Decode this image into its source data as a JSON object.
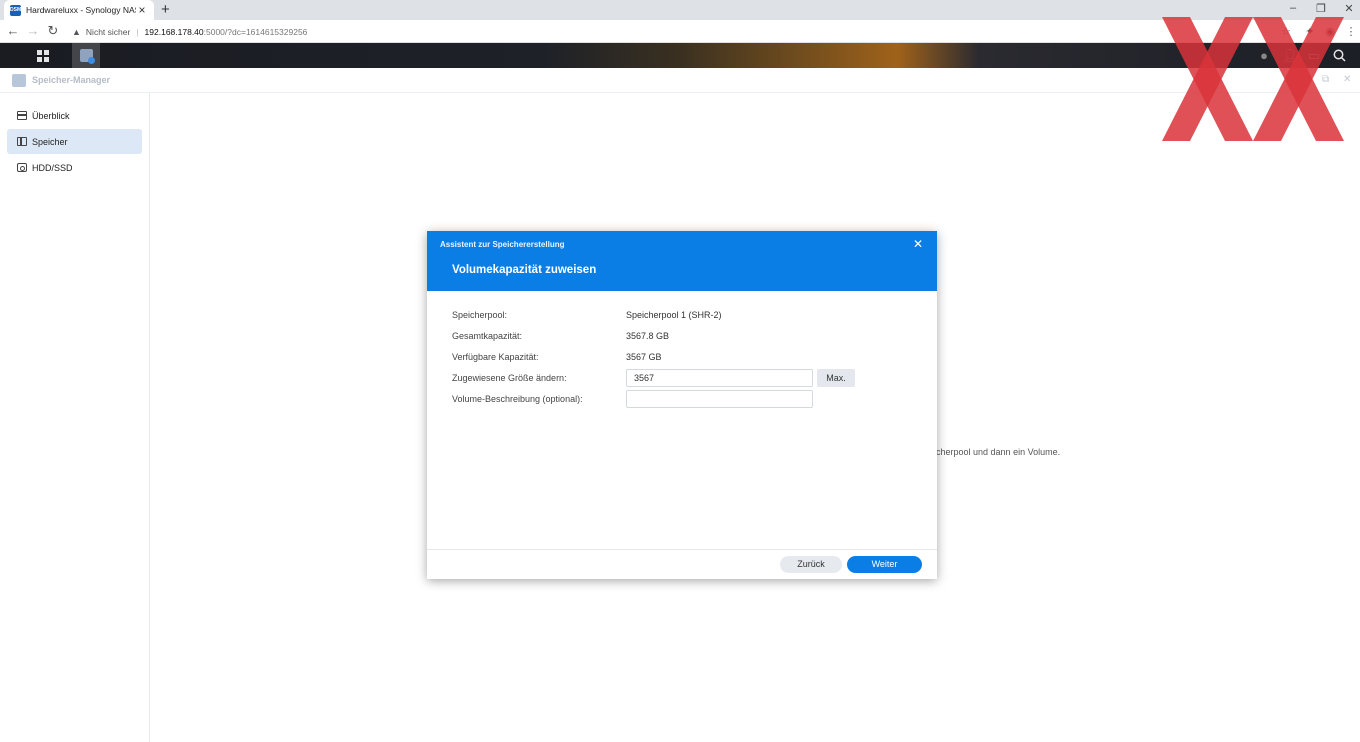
{
  "browser": {
    "tab_title": "Hardwareluxx - Synology NAS",
    "tab_favicon_text": "DSM",
    "not_secure": "Nicht sicher",
    "separator": "|",
    "url_host": "192.168.178.40",
    "url_rest": ":5000/?dc=1614615329256"
  },
  "app": {
    "title": "Speicher-Manager"
  },
  "sidebar": {
    "items": [
      {
        "label": "Überblick",
        "icon": "overview-icon"
      },
      {
        "label": "Speicher",
        "icon": "storage-icon",
        "selected": true
      },
      {
        "label": "HDD/SSD",
        "icon": "disk-icon"
      }
    ]
  },
  "main": {
    "background_text": "cherpool und dann ein Volume."
  },
  "dialog": {
    "wizard_title": "Assistent zur Speichererstellung",
    "step_title": "Volumekapazität zuweisen",
    "rows": {
      "pool": {
        "label": "Speicherpool:",
        "value": "Speicherpool 1 (SHR-2)"
      },
      "total": {
        "label": "Gesamtkapazität:",
        "value": "3567.8 GB"
      },
      "available": {
        "label": "Verfügbare Kapazität:",
        "value": "3567 GB"
      },
      "size": {
        "label": "Zugewiesene Größe ändern:",
        "value": "3567",
        "max_label": "Max."
      },
      "description": {
        "label": "Volume-Beschreibung (optional):",
        "value": ""
      }
    },
    "back_label": "Zurück",
    "next_label": "Weiter"
  },
  "colors": {
    "accent": "#0b7ee6",
    "selected_bg": "#dce8f5",
    "watermark": "#d9333a"
  }
}
